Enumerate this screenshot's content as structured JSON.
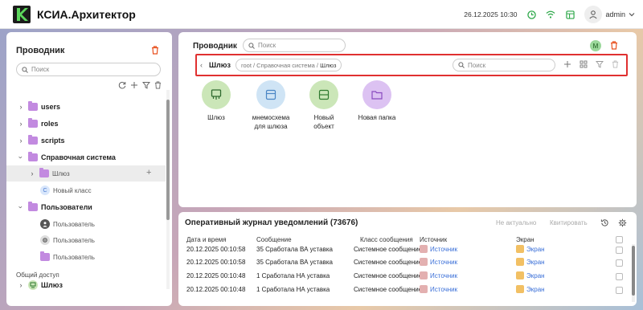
{
  "app": {
    "title": "КСИА.Архитектор",
    "datetime": "26.12.2025 10:30",
    "user": "admin"
  },
  "colors": {
    "accent_red": "#e03030",
    "folder": "#c28ae0",
    "link": "#3a6fd8",
    "green_tile": "#cbe6b8",
    "blue_tile": "#cfe4f5",
    "purple_tile": "#dcc2f2"
  },
  "sidebar": {
    "title": "Проводник",
    "search_placeholder": "Поиск",
    "section_label": "Общий доступ",
    "items": [
      {
        "label": "users",
        "icon": "folder-icon"
      },
      {
        "label": "roles",
        "icon": "folder-icon"
      },
      {
        "label": "scripts",
        "icon": "folder-icon"
      },
      {
        "label": "Справочная система",
        "icon": "folder-icon"
      },
      {
        "label": "Шлюз",
        "icon": "folder-icon"
      },
      {
        "label": "Новый класс",
        "icon": "class-icon"
      },
      {
        "label": "Пользователи",
        "icon": "folder-icon"
      },
      {
        "label": "Пользователь",
        "icon": "user-icon"
      },
      {
        "label": "Пользователь",
        "icon": "user-icon"
      },
      {
        "label": "Пользователь",
        "icon": "folder-icon"
      },
      {
        "label": "Шлюз",
        "icon": "gateway-icon"
      }
    ]
  },
  "explorer": {
    "title": "Проводник",
    "search_placeholder": "Поиск",
    "user_badge": "M",
    "current_name": "Шлюз",
    "crumb_prefix": "root / Справочная система / ",
    "crumb_current": "Шлюз",
    "path_search_placeholder": "Поиск",
    "tiles": [
      {
        "label": "Шлюз",
        "icon": "gateway-icon"
      },
      {
        "label": "мнемосхема",
        "label2": "для шлюза",
        "icon": "mnemo-icon"
      },
      {
        "label": "Новый",
        "label2": "объект",
        "icon": "object-icon"
      },
      {
        "label": "Новая папка",
        "icon": "folder-icon"
      }
    ]
  },
  "journal": {
    "title": "Оперативный журнал уведомлений (73676)",
    "btn_irrelevant": "Не актуально",
    "btn_ack": "Квитировать",
    "headers": {
      "datetime": "Дата и время",
      "message": "Сообщение",
      "class": "Класс сообщения",
      "source": "Источник",
      "screen": "Экран"
    },
    "rows": [
      {
        "datetime": "20.12.2025 00:10:58",
        "message": "35 Сработала ВА уставка",
        "class": "Системное сообщение",
        "source": "Источник",
        "screen": "Экран"
      },
      {
        "datetime": "20.12.2025 00:10:58",
        "message": "35 Сработала ВА уставка",
        "class": "Системное сообщение",
        "source": "Источник",
        "screen": "Экран"
      },
      {
        "datetime": "20.12.2025 00:10:48",
        "message": "1 Сработала НА уставка",
        "class": "Системное сообщение",
        "source": "Источник",
        "screen": "Экран"
      },
      {
        "datetime": "20.12.2025 00:10:48",
        "message": "1 Сработала НА уставка",
        "class": "Системное сообщение",
        "source": "Источник",
        "screen": "Экран"
      }
    ]
  }
}
